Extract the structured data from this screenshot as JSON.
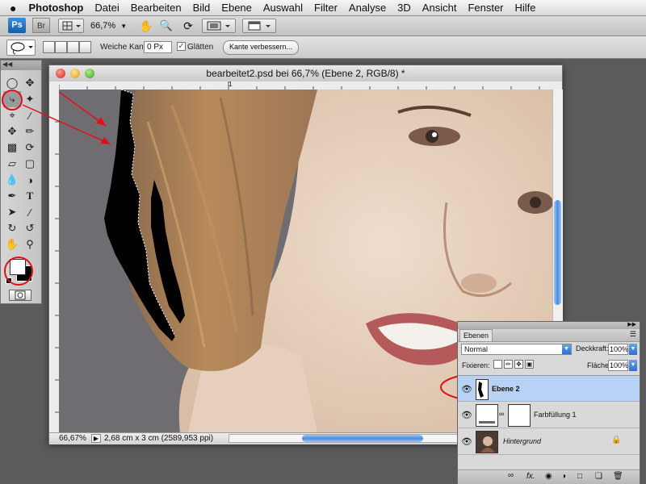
{
  "menubar": {
    "apple": "",
    "app_name": "Photoshop",
    "items": [
      "Datei",
      "Bearbeiten",
      "Bild",
      "Ebene",
      "Auswahl",
      "Filter",
      "Analyse",
      "3D",
      "Ansicht",
      "Fenster",
      "Hilfe"
    ]
  },
  "appbar": {
    "ps_badge": "Ps",
    "br_badge": "Br",
    "zoom": "66,7%"
  },
  "options": {
    "feather_label": "Weiche Kante:",
    "feather_value": "0 Px",
    "antialias_label": "Glätten",
    "antialias_checked": true,
    "refine_button": "Kante verbessern..."
  },
  "document": {
    "title": "bearbeitet2.psd bei 66,7% (Ebene 2, RGB/8) *",
    "ruler_mark": "1",
    "zoom": "66,67%",
    "doc_info": "2,68 cm x 3 cm (2589,953 ppi)"
  },
  "layers_panel": {
    "tab": "Ebenen",
    "blend_mode": "Normal",
    "opacity_label": "Deckkraft:",
    "opacity_value": "100%",
    "lock_label": "Fixieren:",
    "fill_label": "Fläche:",
    "fill_value": "100%",
    "layers": [
      {
        "name": "Ebene 2",
        "selected": true
      },
      {
        "name": "Farbfüllung 1",
        "selected": false
      },
      {
        "name": "Hintergrund",
        "selected": false
      }
    ],
    "footer_link": "fx."
  },
  "colors": {
    "annotation_red": "#e0101a",
    "selection_blue": "#b7d2f5",
    "accent_blue": "#2d78d8"
  }
}
